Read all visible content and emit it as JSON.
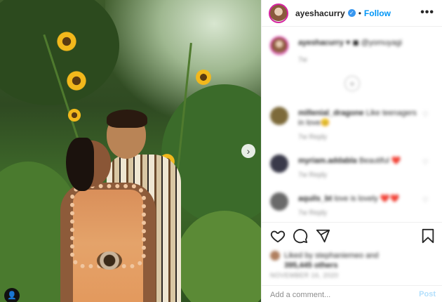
{
  "header": {
    "username": "ayeshacurry",
    "follow_label": "Follow",
    "separator": "•",
    "more_label": "•••",
    "verified_glyph": "✓"
  },
  "caption": {
    "username": "ayeshacurry",
    "text": "♥ ◼ @yomuyagi",
    "time": "7w"
  },
  "comments": [
    {
      "username": "millenial_dragone",
      "text": "Like teenagers in love😊",
      "meta": "7w   Reply"
    },
    {
      "username": "myriam.addabla",
      "text": "Beautiful ❤️",
      "meta": "7w   Reply"
    },
    {
      "username": "aquils_bt",
      "text": "love is lovely ❤️❤️",
      "meta": "7w   Reply"
    }
  ],
  "load_more_label": "+",
  "likes": {
    "line1": "Liked by stephaniemeo and",
    "line2": "395,445 others"
  },
  "date": "NOVEMBER 16, 2020",
  "add_comment": {
    "placeholder": "Add a comment..."
  },
  "post_label": "Post",
  "next_arrow": "›",
  "tag_glyph": "👤",
  "icons": {
    "like": "heart-icon",
    "comment": "comment-icon",
    "share": "share-icon",
    "save": "bookmark-icon"
  },
  "colors": {
    "accent": "#0095f6",
    "post_disabled": "#b2dffc",
    "heart_red": "#ed4956"
  }
}
